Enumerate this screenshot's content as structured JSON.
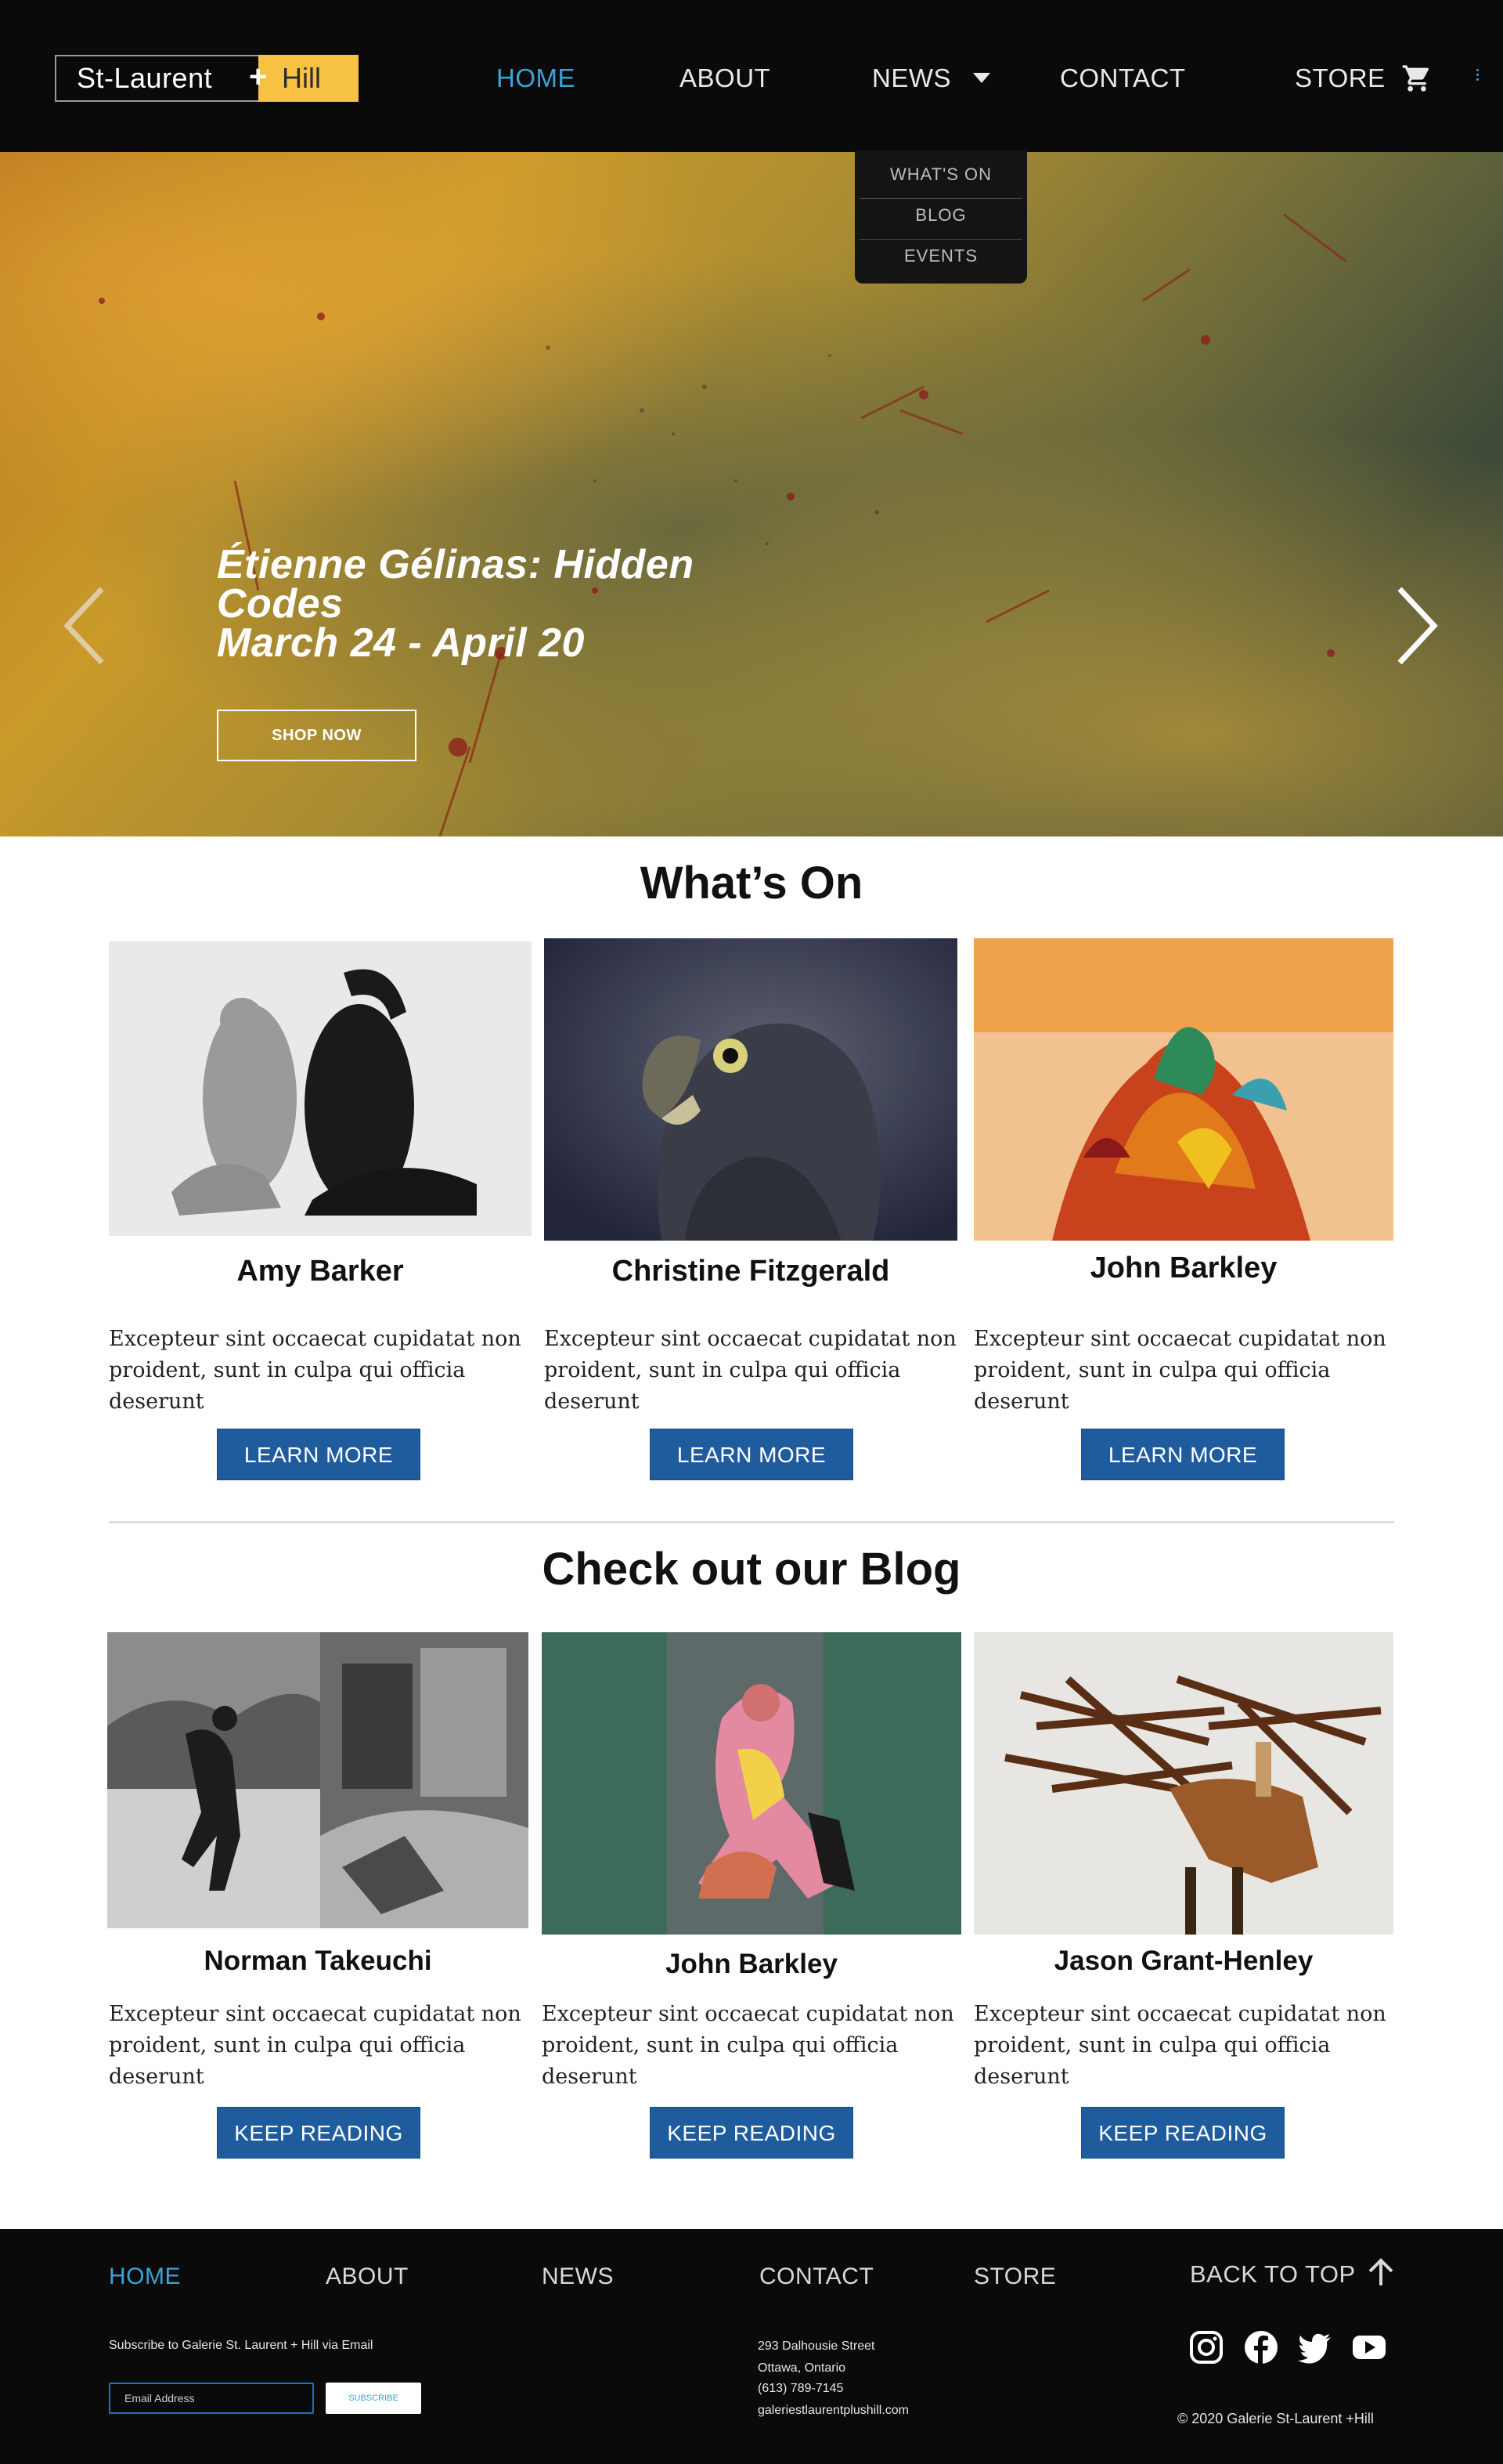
{
  "header": {
    "logo_left": "St-Laurent",
    "logo_right": "Hill",
    "nav": [
      {
        "label": "HOME",
        "active": true
      },
      {
        "label": "ABOUT",
        "active": false
      },
      {
        "label": "NEWS",
        "active": false
      },
      {
        "label": "CONTACT",
        "active": false
      },
      {
        "label": "STORE",
        "active": false
      }
    ],
    "cart_icon": "cart-icon",
    "menu_icon": "kebab-icon"
  },
  "dropdown": {
    "items": [
      "WHAT'S ON",
      "BLOG",
      "EVENTS"
    ]
  },
  "hero": {
    "title_lines": [
      "Étienne Gélinas: Hidden",
      "Codes",
      "March 24 - April 20"
    ],
    "button": "SHOP NOW",
    "slides_count": 5,
    "active_slide": 4
  },
  "whats_on": {
    "title": "What’s On",
    "cards": [
      {
        "name": "Amy Barker",
        "text_line1": "Excepteur sint occaecat cupidatat non",
        "text_line2": "proident, sunt in culpa qui officia deserunt",
        "button": "LEARN MORE"
      },
      {
        "name": "Christine Fitzgerald",
        "text_line1": "Excepteur sint occaecat cupidatat non",
        "text_line2": "proident, sunt in culpa qui officia deserunt",
        "button": "LEARN MORE"
      },
      {
        "name": "John Barkley",
        "text_line1": "Excepteur sint occaecat cupidatat non",
        "text_line2": "proident, sunt in culpa qui officia deserunt",
        "button": "LEARN MORE"
      }
    ]
  },
  "blog": {
    "title": "Check out our Blog",
    "cards": [
      {
        "name": "Norman Takeuchi",
        "text_line1": "Excepteur sint occaecat cupidatat non",
        "text_line2": "proident, sunt in culpa qui officia deserunt",
        "button": "KEEP READING"
      },
      {
        "name": "John Barkley",
        "text_line1": "Excepteur sint occaecat cupidatat non",
        "text_line2": "proident, sunt in culpa qui officia deserunt",
        "button": "KEEP READING"
      },
      {
        "name": "Jason Grant-Henley",
        "text_line1": "Excepteur sint occaecat cupidatat non",
        "text_line2": "proident, sunt in culpa qui officia deserunt",
        "button": "KEEP READING"
      }
    ]
  },
  "footer": {
    "nav": [
      {
        "label": "HOME",
        "active": true
      },
      {
        "label": "ABOUT",
        "active": false
      },
      {
        "label": "NEWS",
        "active": false
      },
      {
        "label": "CONTACT",
        "active": false
      },
      {
        "label": "STORE",
        "active": false
      }
    ],
    "back_to_top": "BACK TO TOP",
    "subscribe_label": "Subscribe to Galerie St. Laurent + Hill via Email",
    "email_placeholder": "Email Address",
    "subscribe_button": "SUBSCRIBE",
    "address": [
      "293 Dalhousie Street",
      "Ottawa, Ontario",
      "(613) 789-7145",
      "galeriestlaurentplushill.com"
    ],
    "social_icons": [
      "instagram-icon",
      "facebook-icon",
      "twitter-icon",
      "youtube-icon"
    ],
    "copyright": "© 2020 Galerie St-Laurent +Hill"
  },
  "colors": {
    "accent": "#3aa3d8",
    "brand_yellow": "#f7c243",
    "button_blue": "#1f5c9e",
    "dark": "#0a0a0b"
  }
}
